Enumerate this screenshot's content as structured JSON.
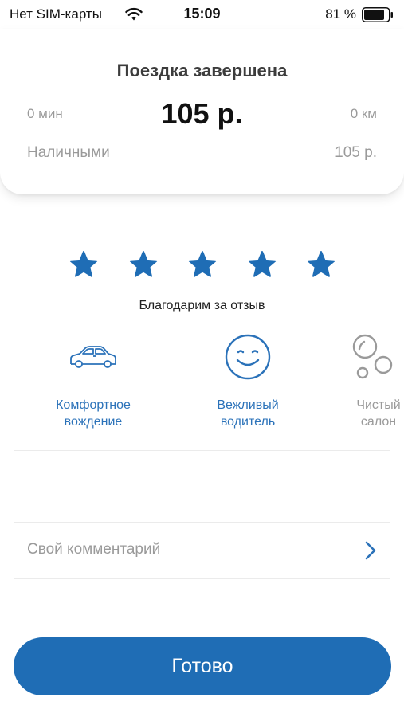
{
  "status_bar": {
    "carrier": "Нет SIM-карты",
    "time": "15:09",
    "battery_percent": "81 %"
  },
  "summary": {
    "title": "Поездка завершена",
    "duration": "0 мин",
    "price": "105 р.",
    "distance": "0 км",
    "payment_method": "Наличными",
    "payment_amount": "105 р."
  },
  "rating": {
    "stars_selected": 5,
    "stars_total": 5,
    "thanks": "Благодарим за отзыв",
    "star_color": "#1f6db5"
  },
  "tags": [
    {
      "label": "Комфортное\nвождение",
      "icon": "car-icon",
      "state": "active"
    },
    {
      "label": "Вежливый\nводитель",
      "icon": "smile-icon",
      "state": "active"
    },
    {
      "label": "Чистый\nсалон",
      "icon": "bubbles-icon",
      "state": "inactive"
    }
  ],
  "comment": {
    "label": "Свой комментарий",
    "icon": "chevron-right-icon"
  },
  "actions": {
    "done_label": "Готово"
  },
  "colors": {
    "accent": "#1f6db5",
    "muted_text": "#9a9a9a"
  }
}
